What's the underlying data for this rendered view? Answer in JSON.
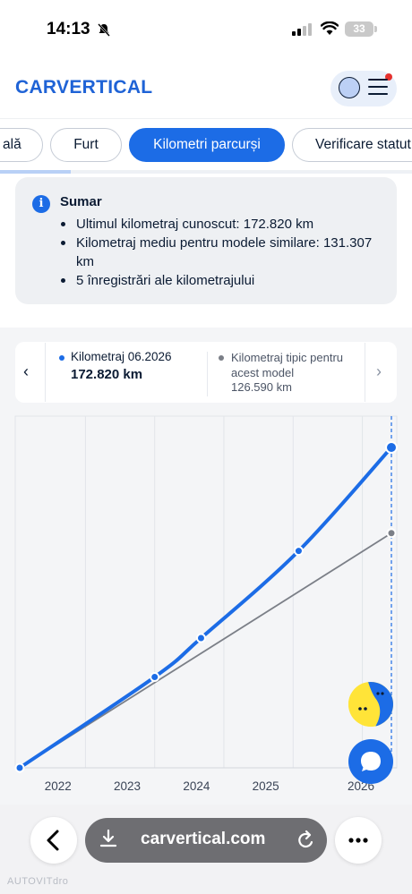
{
  "status_bar": {
    "time": "14:13",
    "battery": "33"
  },
  "header": {
    "logo": "CARVERTICAL"
  },
  "tabs": [
    {
      "label": "ală",
      "active": false
    },
    {
      "label": "Furt",
      "active": false
    },
    {
      "label": "Kilometri parcurși",
      "active": true
    },
    {
      "label": "Verificare statut",
      "active": false
    }
  ],
  "summary": {
    "title": "Sumar",
    "items": [
      "Ultimul kilometraj cunoscut: 172.820 km",
      "Kilometraj mediu pentru modele similare: 131.307 km",
      "5 înregistrări ale kilometrajului"
    ]
  },
  "legend": {
    "series1_label": "Kilometraj 06.2026",
    "series1_value": "172.820 km",
    "series2_label": "Kilometraj tipic pentru acest model",
    "series2_value": "126.590 km"
  },
  "browser": {
    "url": "carvertical.com"
  },
  "watermark": "AUTOVITdro",
  "colors": {
    "accent": "#1c6ce6",
    "typical": "#7b7f87",
    "logo": "#1f63d6"
  },
  "chart_data": {
    "type": "line",
    "x_ticks": [
      "2022",
      "2023",
      "2024",
      "2025",
      "2026"
    ],
    "highlighted_x": "2026",
    "ylim": [
      0,
      180000
    ],
    "series": [
      {
        "name": "Kilometraj",
        "color": "#1c6ce6",
        "points": [
          {
            "x": 2021.05,
            "y": 0
          },
          {
            "x": 2023.0,
            "y": 49000
          },
          {
            "x": 2023.67,
            "y": 70000
          },
          {
            "x": 2025.08,
            "y": 117000
          },
          {
            "x": 2026.42,
            "y": 172820
          }
        ]
      },
      {
        "name": "Kilometraj tipic pentru acest model",
        "color": "#7b7f87",
        "points": [
          {
            "x": 2021.05,
            "y": 0
          },
          {
            "x": 2026.42,
            "y": 126590
          }
        ]
      }
    ]
  }
}
